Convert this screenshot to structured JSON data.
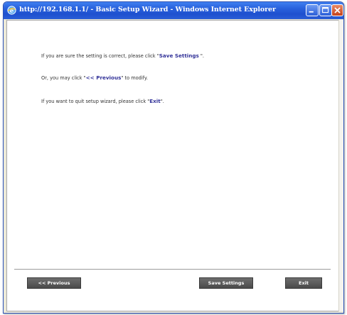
{
  "window": {
    "title": "http://192.168.1.1/ - Basic Setup Wizard - Windows Internet Explorer"
  },
  "messages": {
    "line1_prefix": "If you are sure the setting is correct, please click \"",
    "line1_emph": "Save Settings",
    "line1_suffix": " \".",
    "line2_prefix": "Or, you may click \"",
    "line2_emph": "<< Previous",
    "line2_suffix": "\" to modify.",
    "line3_prefix": "If you want to quit setup wizard, please click \"",
    "line3_emph": "Exit",
    "line3_suffix": "\"."
  },
  "buttons": {
    "previous": "<< Previous",
    "save": "Save Settings",
    "exit": "Exit"
  },
  "colors": {
    "titlebar": "#2a63de",
    "emphasis": "#333399",
    "button": "#5a5a5a"
  }
}
